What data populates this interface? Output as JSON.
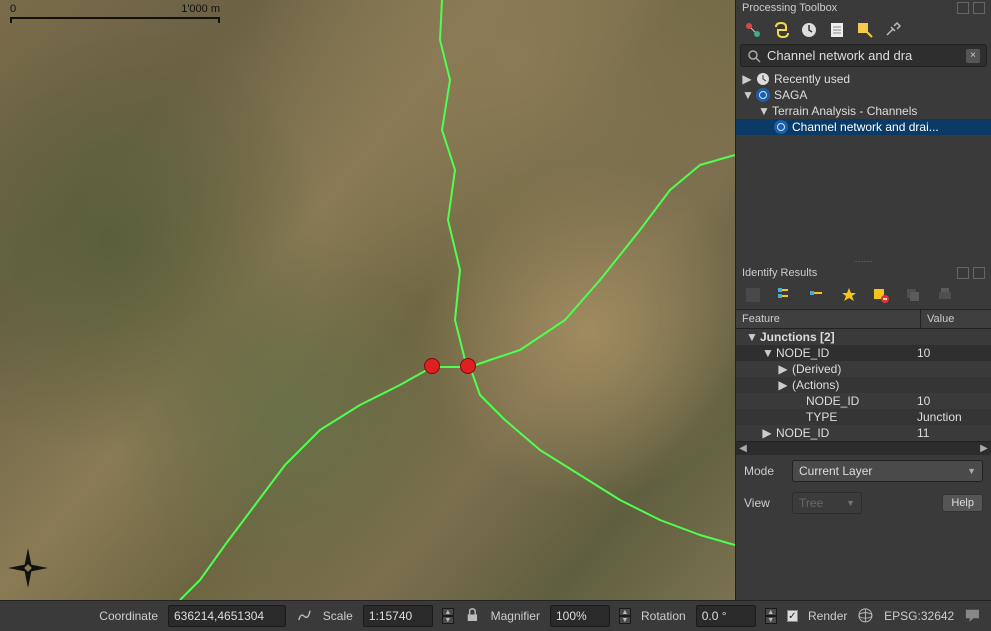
{
  "map": {
    "scale_bar": {
      "left_label": "0",
      "right_label": "1'000 m"
    }
  },
  "processing_toolbox": {
    "title": "Processing Toolbox",
    "search_value": "Channel network and dra",
    "tree": {
      "recent": "Recently used",
      "saga": "SAGA",
      "group": "Terrain Analysis - Channels",
      "algo": "Channel network and drai..."
    }
  },
  "identify": {
    "title": "Identify Results",
    "header_feature": "Feature",
    "header_value": "Value",
    "rows": {
      "layer": "Junctions  [2]",
      "node_a": "NODE_ID",
      "node_a_val": "10",
      "derived": "(Derived)",
      "actions": "(Actions)",
      "attr_node_id": "NODE_ID",
      "attr_node_id_val": "10",
      "attr_type": "TYPE",
      "attr_type_val": "Junction",
      "node_b": "NODE_ID",
      "node_b_val": "11"
    },
    "mode_label": "Mode",
    "mode_value": "Current Layer",
    "view_label": "View",
    "view_value": "Tree",
    "help": "Help"
  },
  "status": {
    "coord_label": "Coordinate",
    "coord_value": "636214,4651304",
    "scale_label": "Scale",
    "scale_value": "1:15740",
    "mag_label": "Magnifier",
    "mag_value": "100%",
    "rot_label": "Rotation",
    "rot_value": "0.0 °",
    "render_label": "Render",
    "crs_label": "EPSG:32642"
  }
}
